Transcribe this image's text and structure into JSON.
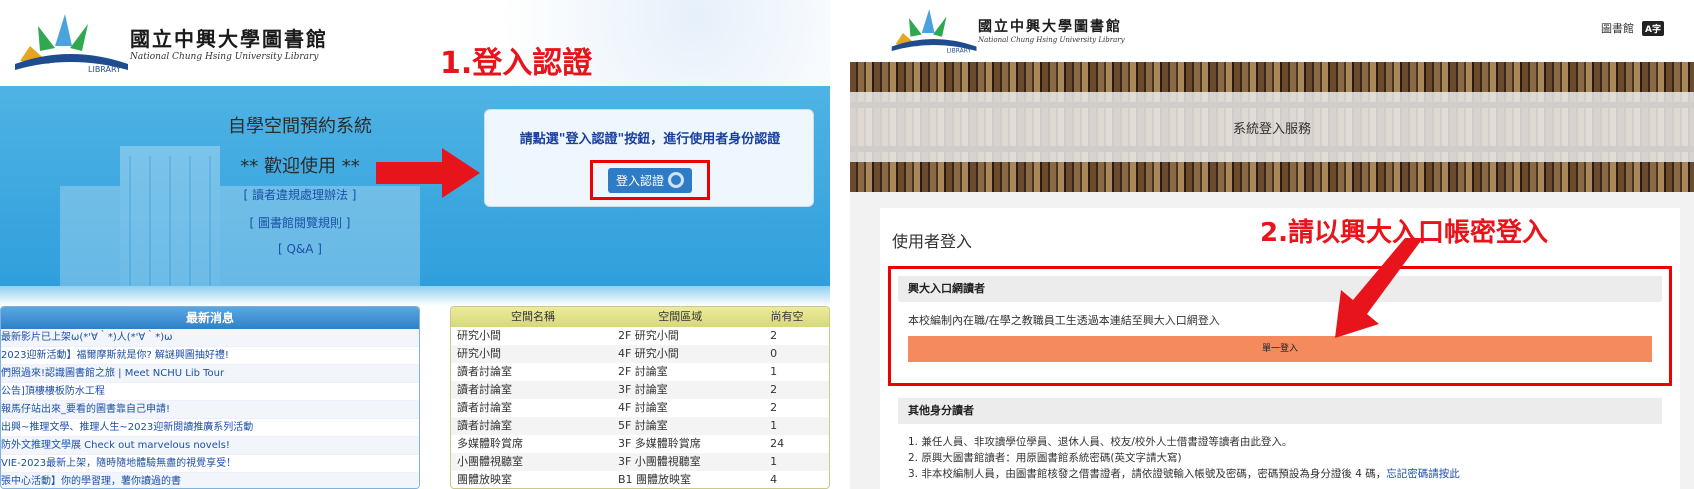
{
  "left": {
    "logo": {
      "zh": "國立中興大學圖書館",
      "en": "National Chung Hsing University Library",
      "badge": "LIBRARY"
    },
    "step_title": "1.登入認證",
    "banner": {
      "title": "自學空間預約系統",
      "welcome": "** 歡迎使用 **",
      "links": [
        "[ 讀者違規處理辦法 ]",
        "[ 圖書館閱覽規則 ]",
        "[ Q&A ]"
      ]
    },
    "auth": {
      "message": "請點選\"登入認證\"按鈕，進行使用者身份認證",
      "button": "登入認證"
    },
    "news": {
      "header": "最新消息",
      "items": [
        "最新影片已上架ω(*'∀｀*)人(*'∀｀*)ω",
        "2023迎新活動】福爾摩斯就是你? 解謎興圖抽好禮!",
        "們照過來!認識圖書館之旅 | Meet NCHU Lib Tour",
        "公告]頂樓樓板防水工程",
        "報馬仔站出來_要看的圖書靠自己申請!",
        "出興~推理文學、推理人生~2023迎新閱讀推廣系列活動",
        "防外文推理文學展 Check out marvelous novels!",
        "VIE-2023最新上架，隨時隨地體驗無盡的視覺享受！",
        "張中心活動】你的學習理，薯你讀過的書"
      ]
    },
    "spaces": {
      "headers": [
        "空間名稱",
        "空間區域",
        "尚有空"
      ],
      "rows": [
        [
          "研究小間",
          "2F 研究小間",
          "2"
        ],
        [
          "研究小間",
          "4F 研究小間",
          "0"
        ],
        [
          "讀者討論室",
          "2F 討論室",
          "1"
        ],
        [
          "讀者討論室",
          "3F 討論室",
          "2"
        ],
        [
          "讀者討論室",
          "4F 討論室",
          "2"
        ],
        [
          "讀者討論室",
          "5F 討論室",
          "1"
        ],
        [
          "多媒體聆賞席",
          "3F 多媒體聆賞席",
          "24"
        ],
        [
          "小團體視聽室",
          "3F 小團體視聽室",
          "1"
        ],
        [
          "團體放映室",
          "B1 團體放映室",
          "4"
        ]
      ]
    }
  },
  "right": {
    "logo": {
      "zh": "國立中興大學圖書館",
      "en": "National Chung Hsing University Library",
      "badge": "LIBRARY"
    },
    "tools": {
      "library": "圖書館",
      "lang": "A字"
    },
    "hero_title": "系統登入服務",
    "step_title": "2.請以興大入口帳密登入",
    "card_title": "使用者登入",
    "portal": {
      "header": "興大入口網讀者",
      "desc": "本校編制內在職/在學之教職員工生透過本連結至興大入口網登入",
      "button": "單一登入"
    },
    "other": {
      "header": "其他身分讀者",
      "lines": [
        "1. 兼任人員、非攻讀學位學員、退休人員、校友/校外人士借書證等讀者由此登入。",
        "2. 原興大圖書館讀者：用原圖書館系統密碼(英文字請大寫)",
        "3. 非本校編制人員，由圖書館核發之借書證者，請依證號輸入帳號及密碼，密碼預設為身分證後 4 碼，"
      ],
      "forgot_link": "忘記密碼請按此"
    }
  }
}
